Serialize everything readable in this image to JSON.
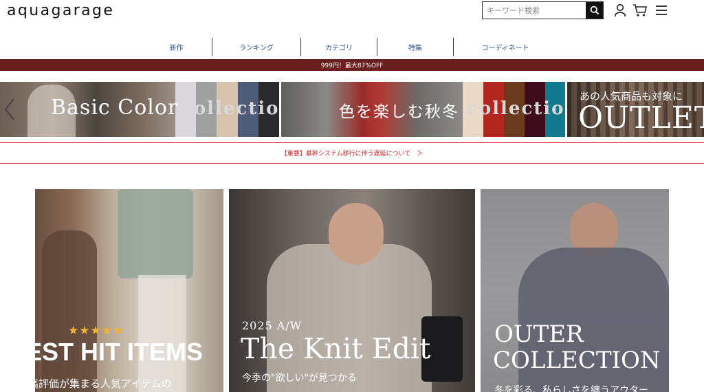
{
  "header": {
    "logo": "aquagarage",
    "search_placeholder": "キーワード検索",
    "search_icon": "search-icon",
    "account_icon": "user-icon",
    "cart_icon": "cart-icon",
    "menu_icon": "hamburger-icon"
  },
  "nav": {
    "items": [
      {
        "label": "新作"
      },
      {
        "label": "ランキング"
      },
      {
        "label": "カテゴリ"
      },
      {
        "label": "特集"
      },
      {
        "label": "コーディネート"
      }
    ]
  },
  "promo": {
    "text": "999円！最大87%OFF",
    "color": "#6a1f1f"
  },
  "carousel": {
    "prev_icon": "chevron-left-icon",
    "slides": [
      {
        "title": "Basic Color",
        "subtitle": "collection"
      },
      {
        "title": "色を楽しむ秋冬",
        "subtitle": "collection"
      },
      {
        "title": "あの人気商品も対象に",
        "subtitle": "OUTLET"
      }
    ]
  },
  "notice": {
    "text": "【重要】基幹システム移行に伴う遅延について　＞",
    "color": "#cc2222"
  },
  "cards": [
    {
      "stars": "★★★★★",
      "title": "BEST HIT ITEMS",
      "subtitle": "高評価が集まる人気アイテムの"
    },
    {
      "season": "2025 A/W",
      "title": "The Knit Edit",
      "subtitle": "今季の\"欲しい\"が見つかる"
    },
    {
      "title_line1": "OUTER",
      "title_line2": "COLLECTION",
      "subtitle": "冬を彩る、私らしさを纏うアウター"
    }
  ]
}
